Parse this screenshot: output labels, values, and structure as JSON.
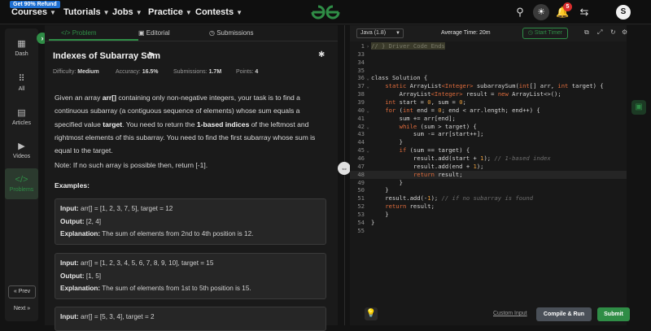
{
  "topbar": {
    "refund_badge": "Get 90% Refund",
    "nav": [
      "Courses",
      "Tutorials",
      "Jobs",
      "Practice",
      "Contests"
    ],
    "logo_text": "GfG",
    "notification_count": "5",
    "avatar_initial": "S"
  },
  "sidebar": {
    "items": [
      {
        "label": "Dash",
        "icon": "grid-icon"
      },
      {
        "label": "All",
        "icon": "apps-icon"
      },
      {
        "label": "Articles",
        "icon": "article-icon"
      },
      {
        "label": "Videos",
        "icon": "video-icon"
      },
      {
        "label": "Problems",
        "icon": "code-icon"
      }
    ],
    "prev_label": "« Prev",
    "next_label": "Next »"
  },
  "problem": {
    "tabs": [
      "</> Problem",
      "Editorial",
      "Submissions"
    ],
    "title": "Indexes of Subarray Sum",
    "meta": {
      "difficulty_label": "Difficulty:",
      "difficulty": "Medium",
      "accuracy_label": "Accuracy:",
      "accuracy": "16.5%",
      "submissions_label": "Submissions:",
      "submissions": "1.7M",
      "points_label": "Points:",
      "points": "4"
    },
    "desc_1": "Given an array ",
    "desc_arr": "arr[]",
    "desc_2": " containing only non-negative integers, your task is to find a continuous subarray (a contiguous sequence of elements) whose sum equals a specified value ",
    "desc_target": "target",
    "desc_3": ". You need to return the ",
    "desc_bold": "1-based indices",
    "desc_4": " of the leftmost and rightmost elements of this subarray. You need to find the first subarray whose sum is equal to the target.",
    "note": "Note: If no such array is possible then, return [-1].",
    "examples_heading": "Examples:",
    "examples": [
      {
        "input": "arr[] = [1, 2, 3, 7, 5], target = 12",
        "output": "[2, 4]",
        "explanation": "The sum of elements from 2nd to 4th position is 12."
      },
      {
        "input": "arr[] = [1, 2, 3, 4, 5, 6, 7, 8, 9, 10], target = 15",
        "output": "[1, 5]",
        "explanation": "The sum of elements from 1st to 5th position is 15."
      },
      {
        "input": "arr[] = [5, 3, 4], target = 2"
      }
    ],
    "input_label": "Input:",
    "output_label": "Output:",
    "explanation_label": "Explanation:"
  },
  "editor": {
    "language": "Java (1.8)",
    "avg_time": "Average Time: 20m",
    "timer_label": "Start Timer",
    "code_lines": [
      {
        "n": "1",
        "fold": "›",
        "html": "<span class=\"folded-box\">// } Driver Code Ends</span>"
      },
      {
        "n": "33",
        "fold": "",
        "html": ""
      },
      {
        "n": "34",
        "fold": "",
        "html": ""
      },
      {
        "n": "35",
        "fold": "",
        "html": ""
      },
      {
        "n": "36",
        "fold": "⌄",
        "html": "class Solution {"
      },
      {
        "n": "37",
        "fold": "⌄",
        "html": "    <span class=\"k\">static</span> ArrayList<span class=\"k\">&lt;Integer&gt;</span> subarraySum(<span class=\"k\">int</span>[] arr, <span class=\"k\">int</span> target) {"
      },
      {
        "n": "38",
        "fold": "",
        "html": "        ArrayList<span class=\"k\">&lt;Integer&gt;</span> result = <span class=\"k\">new</span> ArrayList&lt;&gt;();"
      },
      {
        "n": "39",
        "fold": "",
        "html": "    <span class=\"k\">int</span> start = <span class=\"n\">0</span>, sum = <span class=\"n\">0</span>;"
      },
      {
        "n": "40",
        "fold": "⌄",
        "html": "    <span class=\"k\">for</span> (<span class=\"k\">int</span> end = <span class=\"n\">0</span>; end &lt; arr.length; end++) {"
      },
      {
        "n": "41",
        "fold": "",
        "html": "        sum += arr[end];"
      },
      {
        "n": "42",
        "fold": "⌄",
        "html": "        <span class=\"k\">while</span> (sum &gt; target) {"
      },
      {
        "n": "43",
        "fold": "",
        "html": "            sum -= arr[start++];"
      },
      {
        "n": "44",
        "fold": "",
        "html": "        }"
      },
      {
        "n": "45",
        "fold": "⌄",
        "html": "        <span class=\"k\">if</span> (sum == target) {"
      },
      {
        "n": "46",
        "fold": "",
        "html": "            result.add(start + <span class=\"n\">1</span>); <span class=\"cm\">// 1-based index</span>"
      },
      {
        "n": "47",
        "fold": "",
        "html": "            result.add(end + <span class=\"n\">1</span>);"
      },
      {
        "n": "48",
        "fold": "",
        "html": "            <span class=\"k\">return</span> result;",
        "current": true
      },
      {
        "n": "49",
        "fold": "",
        "html": "        }"
      },
      {
        "n": "50",
        "fold": "",
        "html": "    }"
      },
      {
        "n": "51",
        "fold": "",
        "html": "    result.add(-<span class=\"n\">1</span>); <span class=\"cm\">// if no subarray is found</span>"
      },
      {
        "n": "52",
        "fold": "",
        "html": "    <span class=\"k\">return</span> result;"
      },
      {
        "n": "53",
        "fold": "",
        "html": "    }"
      },
      {
        "n": "54",
        "fold": "",
        "html": "}"
      },
      {
        "n": "55",
        "fold": "",
        "html": ""
      }
    ]
  },
  "actions": {
    "custom_input": "Custom Input",
    "compile_run": "Compile & Run",
    "submit": "Submit"
  },
  "colors": {
    "accent": "#2f8d46",
    "background": "#131313",
    "panel": "#1a1a1a",
    "badge_red": "#d92e2e"
  }
}
